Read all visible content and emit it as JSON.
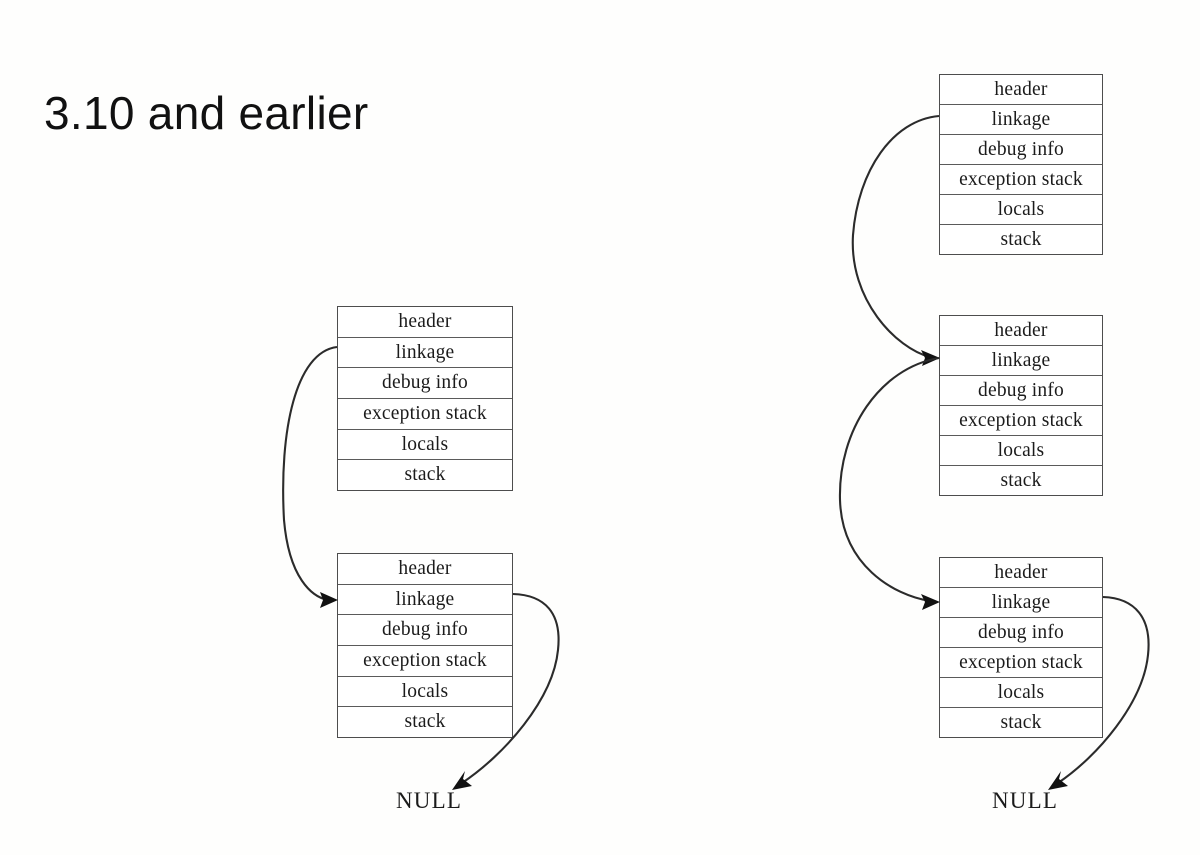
{
  "slide": {
    "title": "3.10 and earlier",
    "background_color": "#fefefd",
    "box_border_color": "#4d4d4d",
    "row_divider_color": "#5a5a5a",
    "arrow_color": "#2b2b2b",
    "text_color": "#1b1b1b"
  },
  "frame_row_labels": {
    "header": "header",
    "linkage": "linkage",
    "debug_info": "debug info",
    "exception_stack": "exception stack",
    "locals": "locals",
    "stack": "stack"
  },
  "columns": [
    {
      "name": "left-column",
      "frames": [
        {
          "id": "left-frame-1",
          "rows": [
            "header",
            "linkage",
            "debug info",
            "exception stack",
            "locals",
            "stack"
          ]
        },
        {
          "id": "left-frame-2",
          "rows": [
            "header",
            "linkage",
            "debug info",
            "exception stack",
            "locals",
            "stack"
          ]
        }
      ],
      "terminator": "NULL"
    },
    {
      "name": "right-column",
      "frames": [
        {
          "id": "right-frame-1",
          "rows": [
            "header",
            "linkage",
            "debug info",
            "exception stack",
            "locals",
            "stack"
          ]
        },
        {
          "id": "right-frame-2",
          "rows": [
            "header",
            "linkage",
            "debug info",
            "exception stack",
            "locals",
            "stack"
          ]
        },
        {
          "id": "right-frame-3",
          "rows": [
            "header",
            "linkage",
            "debug info",
            "exception stack",
            "locals",
            "stack"
          ]
        }
      ],
      "terminator": "NULL"
    }
  ],
  "terminators": {
    "left": "NULL",
    "right": "NULL"
  }
}
